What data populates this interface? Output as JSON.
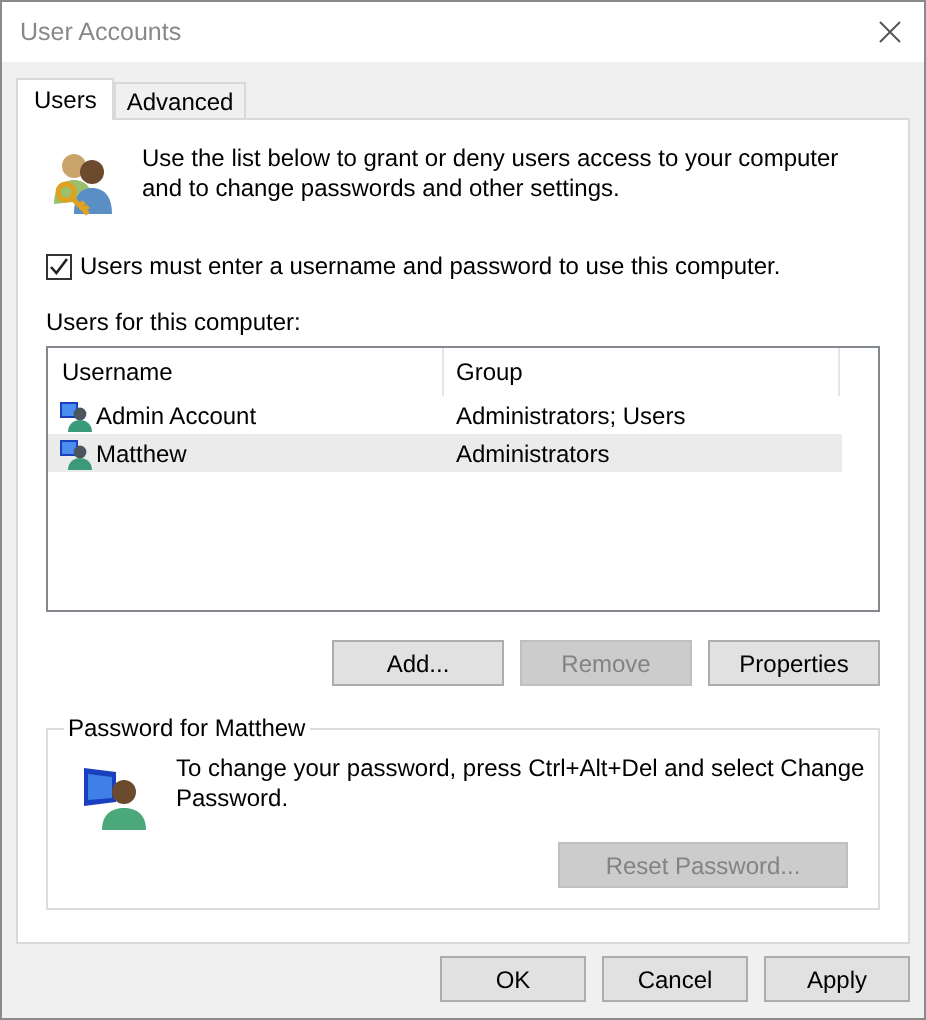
{
  "window": {
    "title": "User Accounts"
  },
  "tabs": [
    {
      "label": "Users",
      "selected": true
    },
    {
      "label": "Advanced",
      "selected": false
    }
  ],
  "intro": "Use the list below to grant or deny users access to your computer and to change passwords and other settings.",
  "login_required": {
    "label": "Users must enter a username and password to use this computer.",
    "checked": true
  },
  "users_list": {
    "label": "Users for this computer:",
    "columns": [
      "Username",
      "Group"
    ],
    "rows": [
      {
        "username": "Admin Account",
        "group": "Administrators; Users",
        "selected": false
      },
      {
        "username": "Matthew",
        "group": "Administrators",
        "selected": true
      }
    ]
  },
  "list_buttons": [
    {
      "label": "Add...",
      "disabled": false
    },
    {
      "label": "Remove",
      "disabled": true
    },
    {
      "label": "Properties",
      "disabled": false
    }
  ],
  "password_group": {
    "title": "Password for Matthew",
    "text": "To change your password, press Ctrl+Alt+Del and select Change Password.",
    "button": {
      "label": "Reset Password...",
      "disabled": true
    }
  },
  "dialog_buttons": [
    {
      "label": "OK",
      "disabled": false
    },
    {
      "label": "Cancel",
      "disabled": false
    },
    {
      "label": "Apply",
      "disabled": false
    }
  ]
}
